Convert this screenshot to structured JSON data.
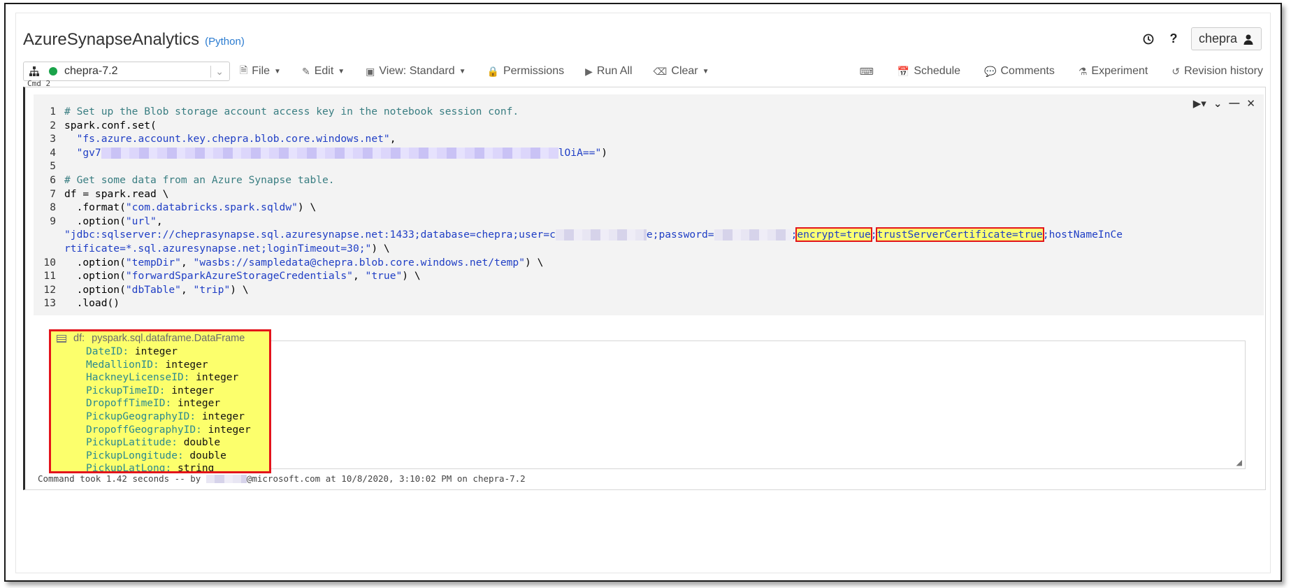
{
  "header": {
    "title": "AzureSynapseAnalytics",
    "language": "(Python)",
    "user": "chepra"
  },
  "toolbar": {
    "cluster": "chepra-7.2",
    "cluster_status_color": "#1aa34a",
    "items_left": [
      "File",
      "Edit",
      "View: Standard",
      "Permissions",
      "Run All",
      "Clear"
    ],
    "items_right": [
      "Schedule",
      "Comments",
      "Experiment",
      "Revision history"
    ]
  },
  "cell": {
    "cmd_label": "Cmd 2",
    "line_numbers": [
      "1",
      "2",
      "3",
      "4",
      "5",
      "6",
      "7",
      "8",
      "9",
      "10",
      "11",
      "12",
      "13"
    ],
    "code": {
      "l1": "# Set up the Blob storage account access key in the notebook session conf.",
      "l2": "spark.conf.set(",
      "l3_str": "\"fs.azure.account.key.chepra.blob.core.windows.net\"",
      "l3_end": ",",
      "l4_start": "\"gv7",
      "l4_end": "lOiA==\"",
      "l4_close": ")",
      "l6": "# Get some data from an Azure Synapse table.",
      "l7": "df = spark.read \\",
      "l8_a": "  .format(",
      "l8_str": "\"com.databricks.spark.sqldw\"",
      "l8_b": ") \\",
      "l9_a": "  .option(",
      "l9_str": "\"url\"",
      "l9_b": ",",
      "l9w1_a": "\"jdbc:sqlserver://cheprasynapse.sql.azuresynapse.net:1433;database=chepra;user=c",
      "l9w1_b": "e;password=",
      "l9w1_c": ";",
      "l9w1_hl1": "encrypt=true",
      "l9w1_sep": ";",
      "l9w1_hl2": "trustServerCertificate=true",
      "l9w1_d": ";hostNameInCe",
      "l9w2_str": "rtificate=*.sql.azuresynapse.net;loginTimeout=30;\"",
      "l9w2_end": ") \\",
      "l10_a": "  .option(",
      "l10_s1": "\"tempDir\"",
      "l10_mid": ", ",
      "l10_s2": "\"wasbs://sampledata@chepra.blob.core.windows.net/temp\"",
      "l10_b": ") \\",
      "l11_a": "  .option(",
      "l11_s1": "\"forwardSparkAzureStorageCredentials\"",
      "l11_mid": ", ",
      "l11_s2": "\"true\"",
      "l11_b": ") \\",
      "l12_a": "  .option(",
      "l12_s1": "\"dbTable\"",
      "l12_mid": ", ",
      "l12_s2": "\"trip\"",
      "l12_b": ") \\",
      "l13": "  .load()"
    }
  },
  "output": {
    "df_name": "df:",
    "df_type": "pyspark.sql.dataframe.DataFrame",
    "schema": [
      {
        "name": "DateID",
        "type": "integer"
      },
      {
        "name": "MedallionID",
        "type": "integer"
      },
      {
        "name": "HackneyLicenseID",
        "type": "integer"
      },
      {
        "name": "PickupTimeID",
        "type": "integer"
      },
      {
        "name": "DropoffTimeID",
        "type": "integer"
      },
      {
        "name": "PickupGeographyID",
        "type": "integer"
      },
      {
        "name": "DropoffGeographyID",
        "type": "integer"
      },
      {
        "name": "PickupLatitude",
        "type": "double"
      },
      {
        "name": "PickupLongitude",
        "type": "double"
      },
      {
        "name": "PickupLatLong",
        "type": "string"
      }
    ],
    "cmd_took_prefix": "Command took 1.42 seconds -- by ",
    "cmd_took_suffix": "@microsoft.com at 10/8/2020, 3:10:02 PM on chepra-7.2"
  },
  "colors": {
    "highlight": "#fbff72",
    "highlight_border": "#e3141b",
    "comment": "#3a7e82",
    "string": "#1f3ec5"
  }
}
